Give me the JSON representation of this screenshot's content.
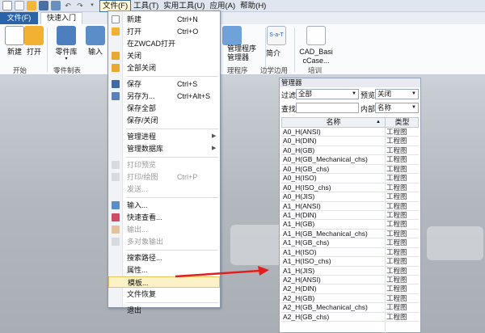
{
  "menubar": {
    "items": [
      "文件(F)",
      "工具(T)",
      "实用工具(U)",
      "应用(A)",
      "帮助(H)"
    ]
  },
  "ribbon_tabs": {
    "file": "文件(F)",
    "quick": "快速入门"
  },
  "ribbon": {
    "buttons": [
      {
        "label": "新建",
        "icon": "new-file-icon"
      },
      {
        "label": "打开",
        "icon": "open-folder-icon"
      },
      {
        "label": "零件库",
        "icon": "parts-library-icon"
      },
      {
        "label": "输入",
        "icon": "import-icon"
      },
      {
        "label": "管理程序",
        "icon": "manager-icon"
      },
      {
        "label": "边学边用",
        "icon": "learn-icon"
      },
      {
        "label": "CAD_Basi",
        "icon": "cad-basic-icon"
      }
    ],
    "extra": {
      "manager_line1": "管理程序",
      "manager_line2": "管理器",
      "jianjie": "简介",
      "cad_line2": "cCase..."
    },
    "groups": [
      "开始",
      "零件制表",
      "理程序",
      "边学边用",
      "培训"
    ]
  },
  "file_menu": [
    {
      "label": "新建",
      "shortcut": "Ctrl+N"
    },
    {
      "label": "打开",
      "shortcut": "Ctrl+O"
    },
    {
      "label": "在ZWCAD打开",
      "shortcut": ""
    },
    {
      "label": "关闭",
      "shortcut": ""
    },
    {
      "label": "全部关闭",
      "shortcut": ""
    },
    {
      "label": "保存",
      "shortcut": "Ctrl+S"
    },
    {
      "label": "另存为...",
      "shortcut": "Ctrl+Alt+S"
    },
    {
      "label": "保存全部",
      "shortcut": ""
    },
    {
      "label": "保存/关闭",
      "shortcut": ""
    },
    {
      "label": "管理进程",
      "shortcut": ""
    },
    {
      "label": "管理数据库",
      "shortcut": ""
    },
    {
      "label": "打印预览",
      "shortcut": ""
    },
    {
      "label": "打印/绘图",
      "shortcut": "Ctrl+P"
    },
    {
      "label": "发送...",
      "shortcut": ""
    },
    {
      "label": "输入...",
      "shortcut": ""
    },
    {
      "label": "快速查看...",
      "shortcut": ""
    },
    {
      "label": "输出...",
      "shortcut": ""
    },
    {
      "label": "多对象输出",
      "shortcut": ""
    },
    {
      "label": "搜索路径...",
      "shortcut": ""
    },
    {
      "label": "属性...",
      "shortcut": ""
    },
    {
      "label": "模板...",
      "shortcut": ""
    },
    {
      "label": "文件恢复",
      "shortcut": ""
    },
    {
      "label": "退出",
      "shortcut": ""
    }
  ],
  "manager": {
    "title": "管理器",
    "filter_label": "过滤",
    "filter_value": "全部",
    "preview_label": "预览",
    "preview_value": "关闭",
    "search_label": "查找",
    "search_value": "",
    "inner_label": "内部",
    "inner_value": "名称",
    "col_name": "名称",
    "col_type": "类型",
    "rows": [
      {
        "name": "A0_H(ANSI)",
        "type": "工程图"
      },
      {
        "name": "A0_H(DIN)",
        "type": "工程图"
      },
      {
        "name": "A0_H(GB)",
        "type": "工程图"
      },
      {
        "name": "A0_H(GB_Mechanical_chs)",
        "type": "工程图"
      },
      {
        "name": "A0_H(GB_chs)",
        "type": "工程图"
      },
      {
        "name": "A0_H(ISO)",
        "type": "工程图"
      },
      {
        "name": "A0_H(ISO_chs)",
        "type": "工程图"
      },
      {
        "name": "A0_H(JIS)",
        "type": "工程图"
      },
      {
        "name": "A1_H(ANSI)",
        "type": "工程图"
      },
      {
        "name": "A1_H(DIN)",
        "type": "工程图"
      },
      {
        "name": "A1_H(GB)",
        "type": "工程图"
      },
      {
        "name": "A1_H(GB_Mechanical_chs)",
        "type": "工程图"
      },
      {
        "name": "A1_H(GB_chs)",
        "type": "工程图"
      },
      {
        "name": "A1_H(ISO)",
        "type": "工程图"
      },
      {
        "name": "A1_H(ISO_chs)",
        "type": "工程图"
      },
      {
        "name": "A1_H(JIS)",
        "type": "工程图"
      },
      {
        "name": "A2_H(ANSI)",
        "type": "工程图"
      },
      {
        "name": "A2_H(DIN)",
        "type": "工程图"
      },
      {
        "name": "A2_H(GB)",
        "type": "工程图"
      },
      {
        "name": "A2_H(GB_Mechanical_chs)",
        "type": "工程图"
      },
      {
        "name": "A2_H(GB_chs)",
        "type": "工程图"
      }
    ]
  },
  "colors": {
    "file_tab": "#2b63a8",
    "highlight": "#fdf1c7",
    "arrow": "#e02020"
  }
}
